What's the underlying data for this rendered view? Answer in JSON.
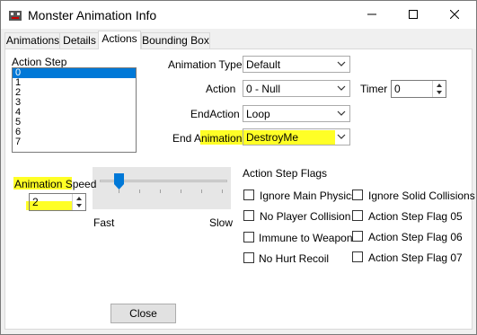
{
  "window": {
    "title": "Monster Animation Info"
  },
  "tabs": [
    {
      "label": "Animations"
    },
    {
      "label": "Details"
    },
    {
      "label": "Actions"
    },
    {
      "label": "Bounding Box"
    }
  ],
  "action_step": {
    "label": "Action Step",
    "items": [
      "0",
      "1",
      "2",
      "3",
      "4",
      "5",
      "6",
      "7"
    ],
    "selected": "0"
  },
  "animation_type": {
    "label": "Animation Type",
    "value": "Default"
  },
  "action": {
    "label": "Action",
    "value": "0 - Null"
  },
  "timer": {
    "label": "Timer",
    "value": "0"
  },
  "end_action": {
    "label": "EndAction",
    "value": "Loop"
  },
  "end_animation": {
    "label": "End Animation",
    "value": "DestroyMe"
  },
  "animation_speed": {
    "label": "Animation Speed",
    "value": "2",
    "fast_label": "Fast",
    "slow_label": "Slow"
  },
  "flags": {
    "label": "Action Step Flags",
    "left": [
      {
        "label": "Ignore Main Physics",
        "checked": false
      },
      {
        "label": "No Player Collision",
        "checked": false
      },
      {
        "label": "Immune to Weapon",
        "checked": false
      },
      {
        "label": "No Hurt Recoil",
        "checked": false
      }
    ],
    "right": [
      {
        "label": "Ignore Solid Collisions",
        "checked": false
      },
      {
        "label": "Action Step Flag 05",
        "checked": false
      },
      {
        "label": "Action Step Flag 06",
        "checked": false
      },
      {
        "label": "Action Step Flag 07",
        "checked": false
      }
    ]
  },
  "close_button": {
    "label": "Close"
  },
  "colors": {
    "highlight": "#ffff00",
    "selection": "#0078d7",
    "slider_thumb": "#0078d7"
  }
}
